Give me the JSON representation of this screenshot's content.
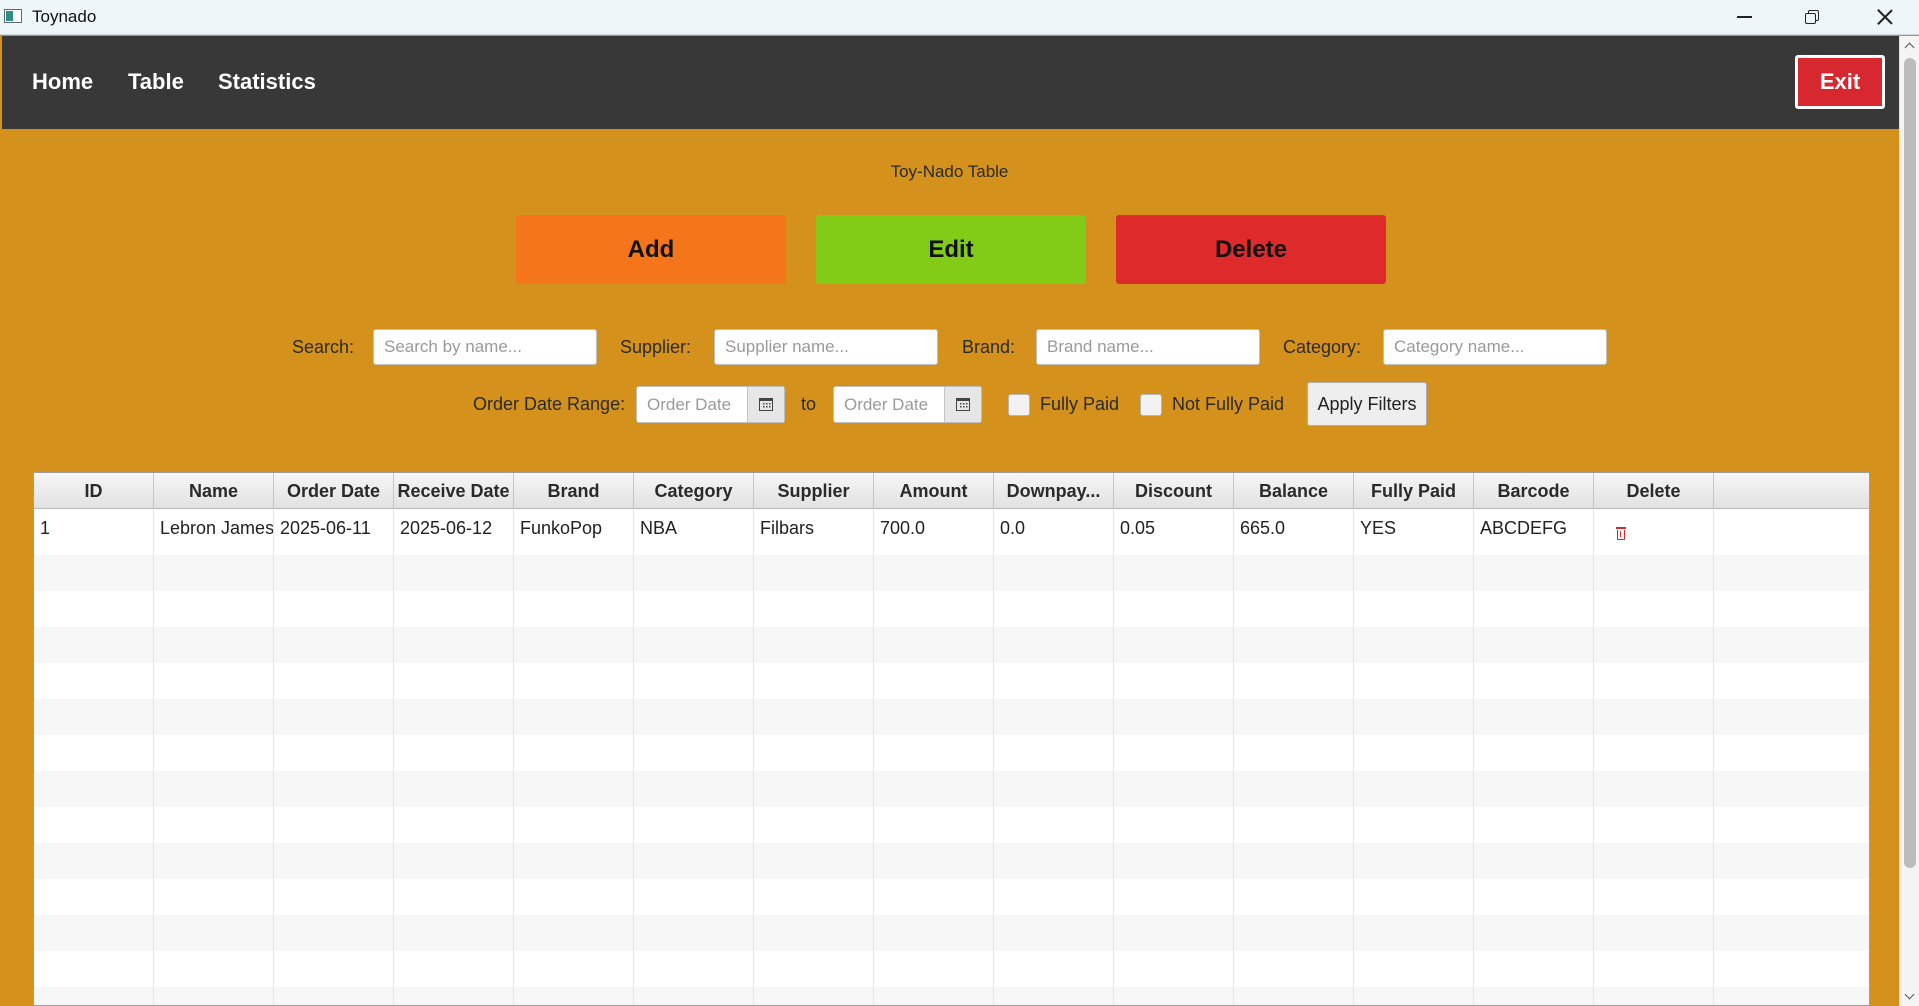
{
  "window": {
    "title": "Toynado"
  },
  "nav": {
    "home": "Home",
    "table": "Table",
    "statistics": "Statistics",
    "exit": "Exit"
  },
  "page": {
    "title": "Toy-Nado Table"
  },
  "actions": {
    "add": "Add",
    "edit": "Edit",
    "delete": "Delete"
  },
  "filters": {
    "search_label": "Search:",
    "search_placeholder": "Search by name...",
    "supplier_label": "Supplier:",
    "supplier_placeholder": "Supplier name...",
    "brand_label": "Brand:",
    "brand_placeholder": "Brand name...",
    "category_label": "Category:",
    "category_placeholder": "Category name...",
    "date_range_label": "Order Date Range:",
    "date_from_placeholder": "Order Date",
    "to_label": "to",
    "date_to_placeholder": "Order Date",
    "fully_paid_label": "Fully Paid",
    "not_fully_paid_label": "Not Fully Paid",
    "apply_label": "Apply Filters"
  },
  "table": {
    "columns": [
      "ID",
      "Name",
      "Order Date",
      "Receive Date",
      "Brand",
      "Category",
      "Supplier",
      "Amount",
      "Downpay...",
      "Discount",
      "Balance",
      "Fully Paid",
      "Barcode",
      "Delete"
    ],
    "rows": [
      [
        "1",
        "Lebron James",
        "2025-06-11",
        "2025-06-12",
        "FunkoPop",
        "NBA",
        "Filbars",
        "700.0",
        "0.0",
        "0.05",
        "665.0",
        "YES",
        "ABCDEFG",
        ""
      ]
    ]
  },
  "colors": {
    "background": "#d4911c",
    "navbar": "#383838",
    "exit": "#d7282f",
    "add": "#f5761a",
    "edit": "#82cc18",
    "delete": "#de2a2a"
  }
}
